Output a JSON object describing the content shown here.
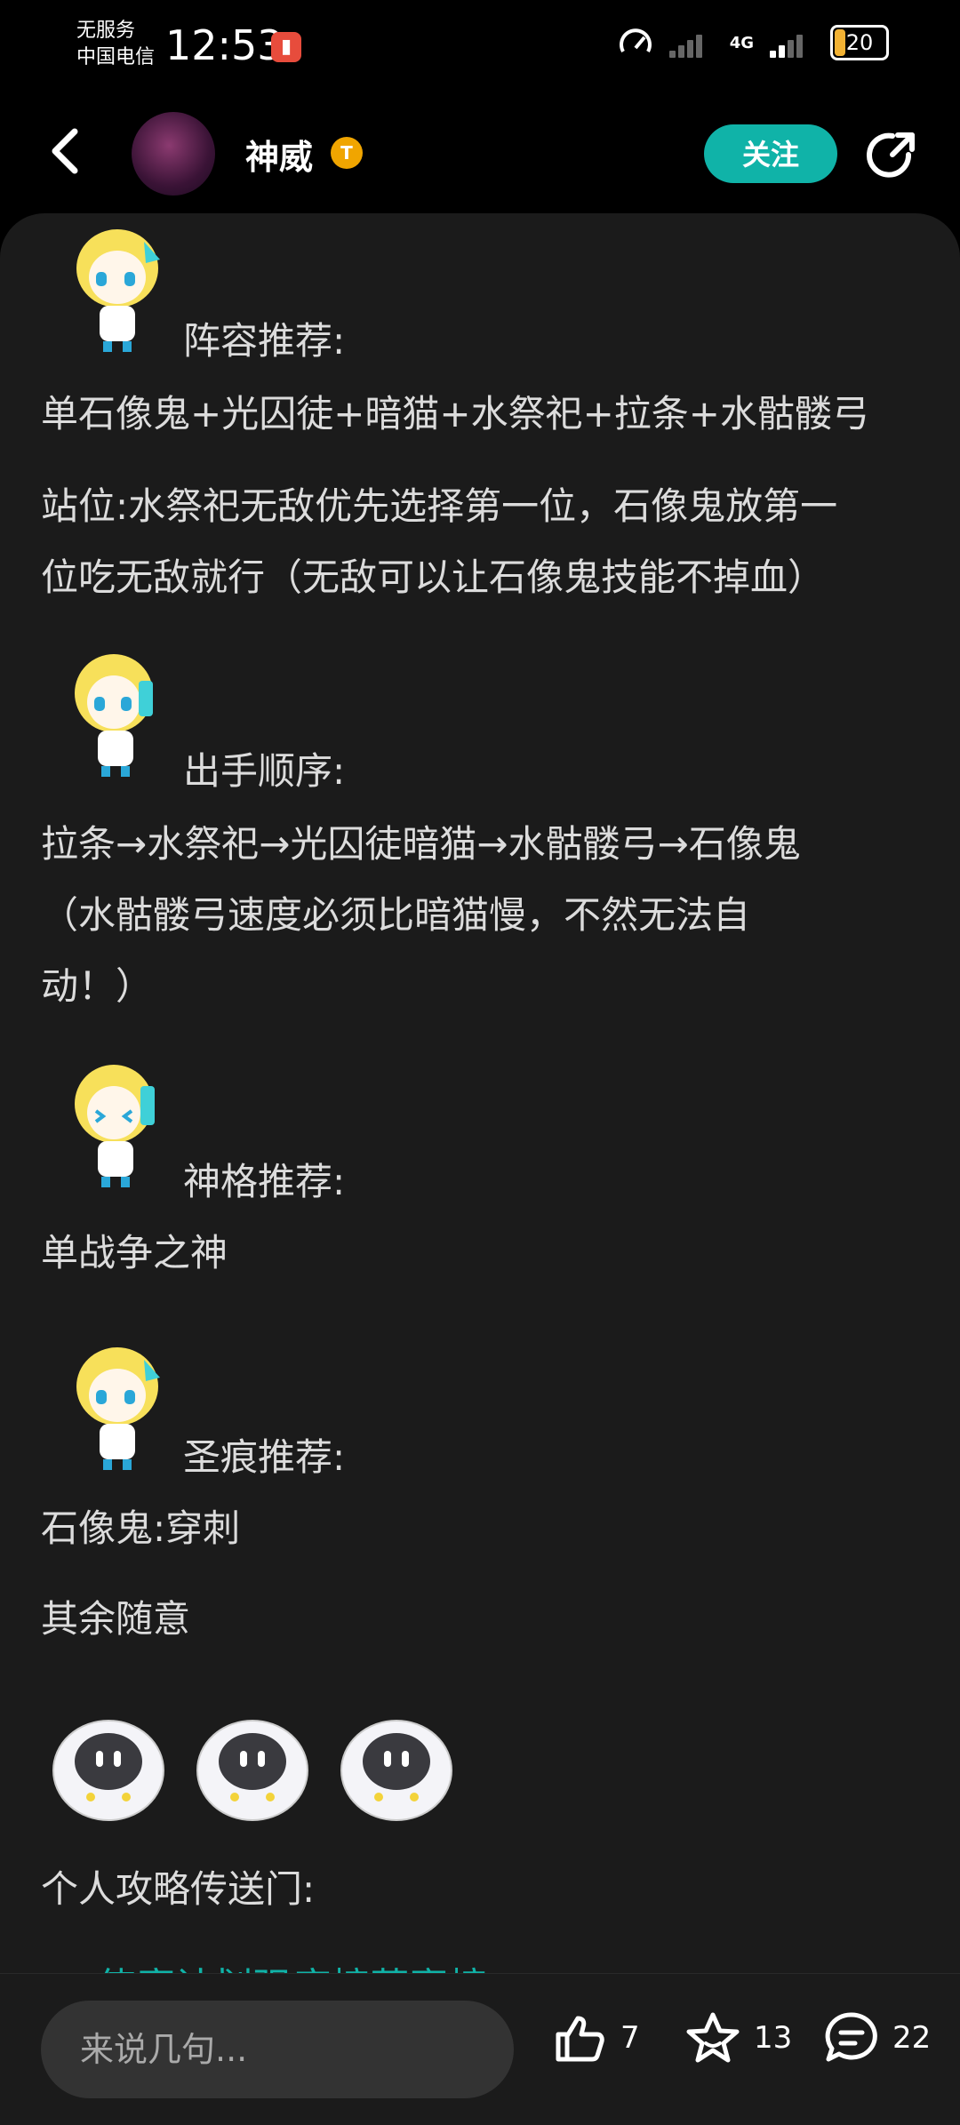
{
  "status_bar": {
    "carrier_line1": "无服务",
    "carrier_line2": "中国电信",
    "time": "12:53",
    "network": "4G",
    "battery": "20"
  },
  "header": {
    "username": "神威",
    "badge": "T",
    "follow_label": "关注"
  },
  "post": {
    "lineup_heading": "阵容推荐:",
    "lineup": "单石像鬼+光囚徒+暗猫+水祭祀+拉条+水骷髅弓",
    "position_line1": "站位:水祭祀无敌优先选择第一位，石像鬼放第一",
    "position_line2": "位吃无敌就行（无敌可以让石像鬼技能不掉血）",
    "order_heading": "出手顺序:",
    "order_line1": "拉条→水祭祀→光囚徒暗猫→水骷髅弓→石像鬼",
    "order_line2": "（水骷髅弓速度必须比暗猫慢，不然无法自",
    "order_line3": "动！）",
    "divinity_heading": "神格推荐:",
    "divinity": "单战争之神",
    "mark_heading": "圣痕推荐:",
    "mark": "石像鬼:穿刺",
    "others": "其余随意",
    "guide_portal": "个人攻略传送门:",
    "link_text": "◎ 使魔计划强度榜草案榜"
  },
  "bottom_bar": {
    "comment_placeholder": "来说几句...",
    "likes": "7",
    "favorites": "13",
    "comments": "22"
  }
}
